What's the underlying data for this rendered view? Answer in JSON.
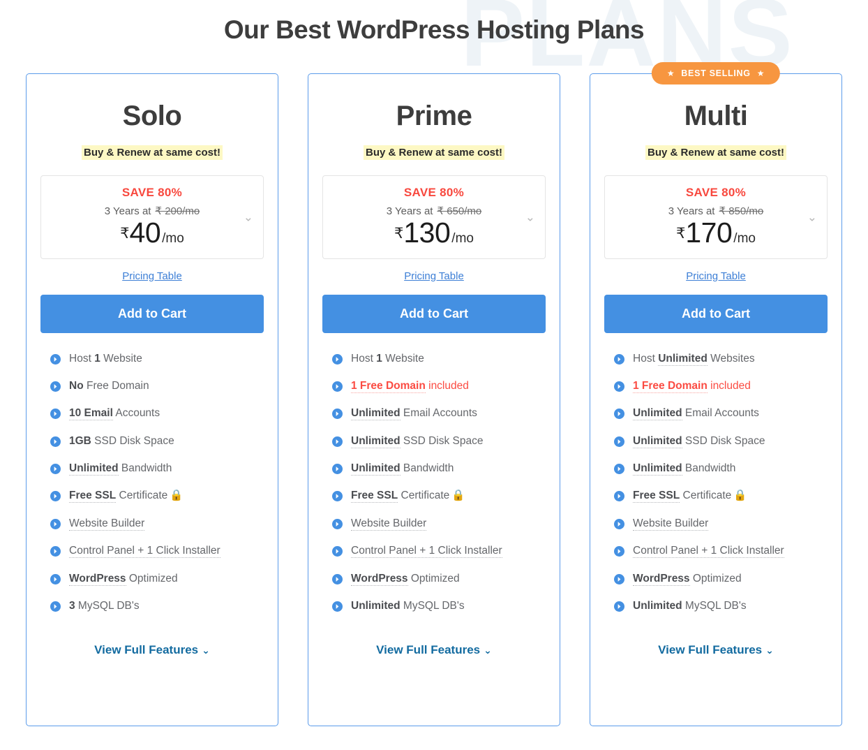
{
  "header": {
    "title": "Our Best WordPress Hosting Plans",
    "watermark": "PLANS"
  },
  "colors": {
    "card_border": "#5b9bea",
    "accent_blue": "#4490e2",
    "badge_orange": "#f79640",
    "save_red": "#f8483e",
    "feature_red": "#fb4b42",
    "highlight_yellow": "#fdf8c4",
    "link_blue": "#136ba0",
    "watermark": "#eef3f7"
  },
  "common": {
    "renew_note": "Buy & Renew at same cost!",
    "save_label": "SAVE 80%",
    "term_prefix": "3 Years at",
    "currency": "₹",
    "per": "/mo",
    "pricing_table_label": "Pricing Table",
    "add_to_cart_label": "Add to Cart",
    "view_full_label": "View Full Features",
    "chevron_down": "⌄",
    "bullet_icon": "arrow-right-circle-icon",
    "lock_icon": "🔒",
    "star_icon": "★"
  },
  "plans": [
    {
      "name": "Solo",
      "badge": null,
      "save": "SAVE 80%",
      "term": "3 Years at",
      "old_price": "₹ 200/mo",
      "price": "40",
      "features": [
        {
          "parts": [
            {
              "text": "Host ",
              "bold": false,
              "dotted": false
            },
            {
              "text": "1",
              "bold": true,
              "dotted": false
            },
            {
              "text": " Website",
              "bold": false,
              "dotted": false
            }
          ],
          "red": false,
          "lock": false
        },
        {
          "parts": [
            {
              "text": "No",
              "bold": true,
              "dotted": false
            },
            {
              "text": " Free Domain",
              "bold": false,
              "dotted": false
            }
          ],
          "red": false,
          "lock": false
        },
        {
          "parts": [
            {
              "text": "10 Email",
              "bold": true,
              "dotted": true
            },
            {
              "text": " Accounts",
              "bold": false,
              "dotted": false
            }
          ],
          "red": false,
          "lock": false
        },
        {
          "parts": [
            {
              "text": "1GB",
              "bold": true,
              "dotted": false
            },
            {
              "text": " SSD Disk Space",
              "bold": false,
              "dotted": false
            }
          ],
          "red": false,
          "lock": false
        },
        {
          "parts": [
            {
              "text": "Unlimited",
              "bold": true,
              "dotted": true
            },
            {
              "text": " Bandwidth",
              "bold": false,
              "dotted": false
            }
          ],
          "red": false,
          "lock": false
        },
        {
          "parts": [
            {
              "text": "Free SSL",
              "bold": true,
              "dotted": true
            },
            {
              "text": " Certificate",
              "bold": false,
              "dotted": false
            }
          ],
          "red": false,
          "lock": true
        },
        {
          "parts": [
            {
              "text": "Website Builder",
              "bold": false,
              "dotted": true
            }
          ],
          "red": false,
          "lock": false
        },
        {
          "parts": [
            {
              "text": "Control Panel + 1 Click Installer",
              "bold": false,
              "dotted": true
            }
          ],
          "red": false,
          "lock": false
        },
        {
          "parts": [
            {
              "text": "WordPress",
              "bold": true,
              "dotted": true
            },
            {
              "text": " Optimized",
              "bold": false,
              "dotted": false
            }
          ],
          "red": false,
          "lock": false
        },
        {
          "parts": [
            {
              "text": "3",
              "bold": true,
              "dotted": false
            },
            {
              "text": " MySQL DB's",
              "bold": false,
              "dotted": false
            }
          ],
          "red": false,
          "lock": false
        }
      ]
    },
    {
      "name": "Prime",
      "badge": null,
      "save": "SAVE 80%",
      "term": "3 Years at",
      "old_price": "₹ 650/mo",
      "price": "130",
      "features": [
        {
          "parts": [
            {
              "text": "Host ",
              "bold": false,
              "dotted": false
            },
            {
              "text": "1",
              "bold": true,
              "dotted": false
            },
            {
              "text": " Website",
              "bold": false,
              "dotted": false
            }
          ],
          "red": false,
          "lock": false
        },
        {
          "parts": [
            {
              "text": "1 Free Domain",
              "bold": true,
              "dotted": true
            },
            {
              "text": " included",
              "bold": false,
              "dotted": false
            }
          ],
          "red": true,
          "lock": false
        },
        {
          "parts": [
            {
              "text": "Unlimited",
              "bold": true,
              "dotted": true
            },
            {
              "text": " Email Accounts",
              "bold": false,
              "dotted": false
            }
          ],
          "red": false,
          "lock": false
        },
        {
          "parts": [
            {
              "text": "Unlimited",
              "bold": true,
              "dotted": true
            },
            {
              "text": " SSD Disk Space",
              "bold": false,
              "dotted": false
            }
          ],
          "red": false,
          "lock": false
        },
        {
          "parts": [
            {
              "text": "Unlimited",
              "bold": true,
              "dotted": true
            },
            {
              "text": " Bandwidth",
              "bold": false,
              "dotted": false
            }
          ],
          "red": false,
          "lock": false
        },
        {
          "parts": [
            {
              "text": "Free SSL",
              "bold": true,
              "dotted": true
            },
            {
              "text": " Certificate",
              "bold": false,
              "dotted": false
            }
          ],
          "red": false,
          "lock": true
        },
        {
          "parts": [
            {
              "text": "Website Builder",
              "bold": false,
              "dotted": true
            }
          ],
          "red": false,
          "lock": false
        },
        {
          "parts": [
            {
              "text": "Control Panel + 1 Click Installer",
              "bold": false,
              "dotted": true
            }
          ],
          "red": false,
          "lock": false
        },
        {
          "parts": [
            {
              "text": "WordPress",
              "bold": true,
              "dotted": true
            },
            {
              "text": " Optimized",
              "bold": false,
              "dotted": false
            }
          ],
          "red": false,
          "lock": false
        },
        {
          "parts": [
            {
              "text": "Unlimited",
              "bold": true,
              "dotted": false
            },
            {
              "text": " MySQL DB's",
              "bold": false,
              "dotted": false
            }
          ],
          "red": false,
          "lock": false
        }
      ]
    },
    {
      "name": "Multi",
      "badge": "BEST SELLING",
      "save": "SAVE 80%",
      "term": "3 Years at",
      "old_price": "₹ 850/mo",
      "price": "170",
      "features": [
        {
          "parts": [
            {
              "text": "Host ",
              "bold": false,
              "dotted": false
            },
            {
              "text": "Unlimited",
              "bold": true,
              "dotted": true
            },
            {
              "text": " Websites",
              "bold": false,
              "dotted": false
            }
          ],
          "red": false,
          "lock": false
        },
        {
          "parts": [
            {
              "text": "1 Free Domain",
              "bold": true,
              "dotted": true
            },
            {
              "text": " included",
              "bold": false,
              "dotted": false
            }
          ],
          "red": true,
          "lock": false
        },
        {
          "parts": [
            {
              "text": "Unlimited",
              "bold": true,
              "dotted": true
            },
            {
              "text": " Email Accounts",
              "bold": false,
              "dotted": false
            }
          ],
          "red": false,
          "lock": false
        },
        {
          "parts": [
            {
              "text": "Unlimited",
              "bold": true,
              "dotted": true
            },
            {
              "text": " SSD Disk Space",
              "bold": false,
              "dotted": false
            }
          ],
          "red": false,
          "lock": false
        },
        {
          "parts": [
            {
              "text": "Unlimited",
              "bold": true,
              "dotted": true
            },
            {
              "text": " Bandwidth",
              "bold": false,
              "dotted": false
            }
          ],
          "red": false,
          "lock": false
        },
        {
          "parts": [
            {
              "text": "Free SSL",
              "bold": true,
              "dotted": true
            },
            {
              "text": " Certificate",
              "bold": false,
              "dotted": false
            }
          ],
          "red": false,
          "lock": true
        },
        {
          "parts": [
            {
              "text": "Website Builder",
              "bold": false,
              "dotted": true
            }
          ],
          "red": false,
          "lock": false
        },
        {
          "parts": [
            {
              "text": "Control Panel + 1 Click Installer",
              "bold": false,
              "dotted": true
            }
          ],
          "red": false,
          "lock": false
        },
        {
          "parts": [
            {
              "text": "WordPress",
              "bold": true,
              "dotted": true
            },
            {
              "text": " Optimized",
              "bold": false,
              "dotted": false
            }
          ],
          "red": false,
          "lock": false
        },
        {
          "parts": [
            {
              "text": "Unlimited",
              "bold": true,
              "dotted": false
            },
            {
              "text": " MySQL DB's",
              "bold": false,
              "dotted": false
            }
          ],
          "red": false,
          "lock": false
        }
      ]
    }
  ]
}
